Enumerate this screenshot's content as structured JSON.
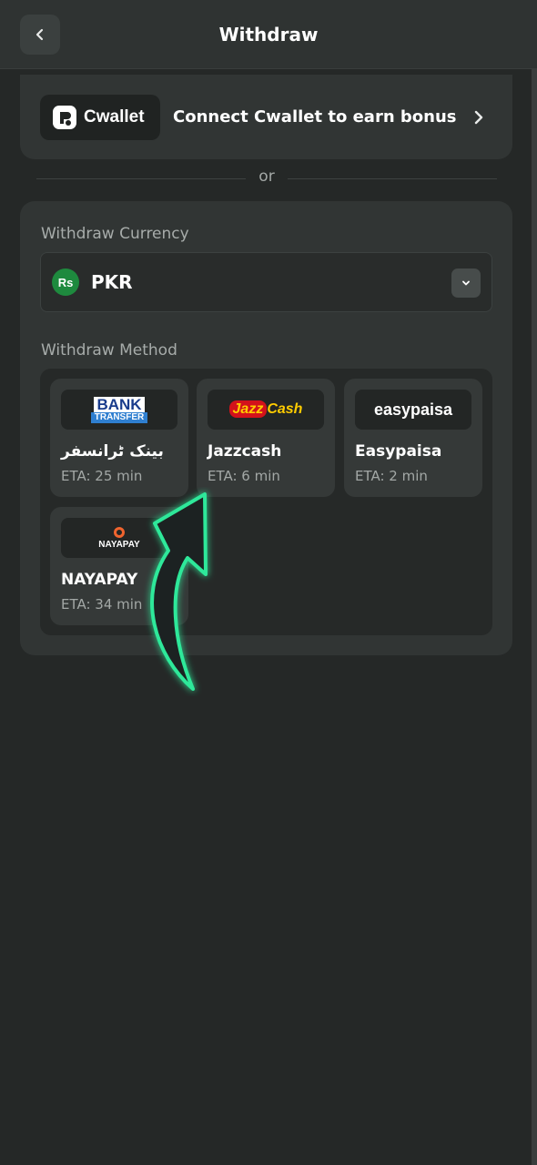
{
  "header": {
    "title": "Withdraw",
    "back_icon": "chevron-left-icon"
  },
  "cwallet": {
    "logo_text": "Cwallet",
    "text": "Connect Cwallet to earn bonus",
    "chevron_icon": "chevron-right-icon"
  },
  "divider_text": "or",
  "currency": {
    "label": "Withdraw Currency",
    "symbol": "Rs",
    "code": "PKR",
    "dropdown_icon": "chevron-down-icon",
    "symbol_color": "#1e8a3e"
  },
  "methods_section": {
    "label": "Withdraw Method",
    "items": [
      {
        "name": "بینک ٹرانسفر",
        "eta": "ETA: 25 min",
        "logo_line1": "BANK",
        "logo_line2": "TRANSFER"
      },
      {
        "name": "Jazzcash",
        "eta": "ETA: 6 min",
        "logo_line1": "Jazz",
        "logo_line2": "Cash"
      },
      {
        "name": "Easypaisa",
        "eta": "ETA: 2 min",
        "logo_line1": "easypaisa"
      },
      {
        "name": "NAYAPAY",
        "eta": "ETA: 34 min",
        "logo_line1": "NAYAPAY"
      }
    ]
  },
  "colors": {
    "background": "#252827",
    "card": "#313534",
    "accent_arrow": "#2ee89a"
  }
}
